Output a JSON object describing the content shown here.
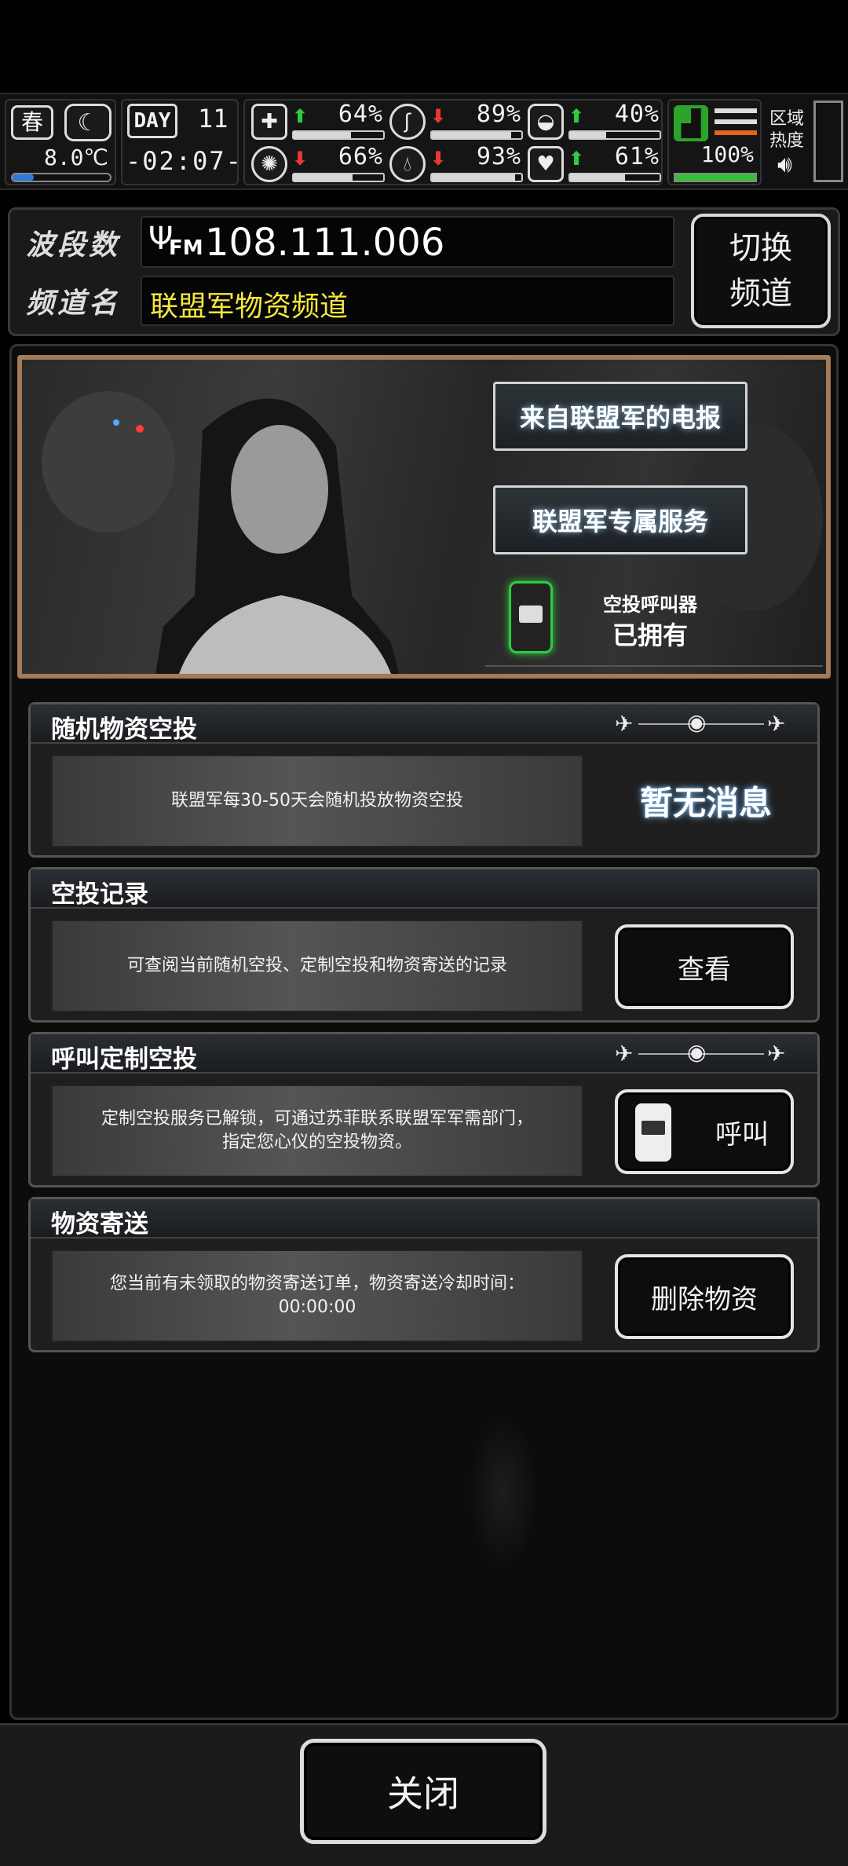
{
  "hud": {
    "season": "春",
    "temperature": "8.0℃",
    "day_label": "DAY",
    "day_number": "11",
    "clock": "-02:07-",
    "stats": [
      {
        "name": "health",
        "arrow": "up",
        "pct": "64%",
        "fill": 0.64
      },
      {
        "name": "stomach",
        "arrow": "down",
        "pct": "89%",
        "fill": 0.89
      },
      {
        "name": "stamina",
        "arrow": "up",
        "pct": "40%",
        "fill": 0.4
      },
      {
        "name": "mind",
        "arrow": "down",
        "pct": "66%",
        "fill": 0.66
      },
      {
        "name": "water",
        "arrow": "down",
        "pct": "93%",
        "fill": 0.93
      },
      {
        "name": "mood",
        "arrow": "up",
        "pct": "61%",
        "fill": 0.61
      }
    ],
    "boots_pct": "100%",
    "region_heat_label": "区域热度"
  },
  "radio": {
    "band_label": "波段数",
    "frequency": "108.111.006",
    "fm_label": "FM",
    "channel_label": "频道名",
    "channel_name": "联盟军物资频道",
    "switch_label_1": "切换",
    "switch_label_2": "频道"
  },
  "banner": {
    "telegram_btn": "来自联盟军的电报",
    "service_btn": "联盟军专属服务",
    "device_name": "空投呼叫器",
    "device_status": "已拥有"
  },
  "sections": {
    "random_drop": {
      "title": "随机物资空投",
      "desc": "联盟军每30-50天会随机投放物资空投",
      "status": "暂无消息"
    },
    "records": {
      "title": "空投记录",
      "desc": "可查阅当前随机空投、定制空投和物资寄送的记录",
      "button": "查看"
    },
    "custom_drop": {
      "title": "呼叫定制空投",
      "desc": "定制空投服务已解锁，可通过苏菲联系联盟军军需部门，指定您心仪的空投物资。",
      "button": "呼叫"
    },
    "delivery": {
      "title": "物资寄送",
      "desc": "您当前有未领取的物资寄送订单，物资寄送冷却时间：00:00:00",
      "button": "删除物资"
    }
  },
  "footer": {
    "close_label": "关闭"
  },
  "colors": {
    "accent_yellow": "#f5e63a",
    "up_green": "#2ecc40",
    "down_red": "#e53935",
    "banner_frame": "#a47b55",
    "boots_green": "#35c035"
  }
}
